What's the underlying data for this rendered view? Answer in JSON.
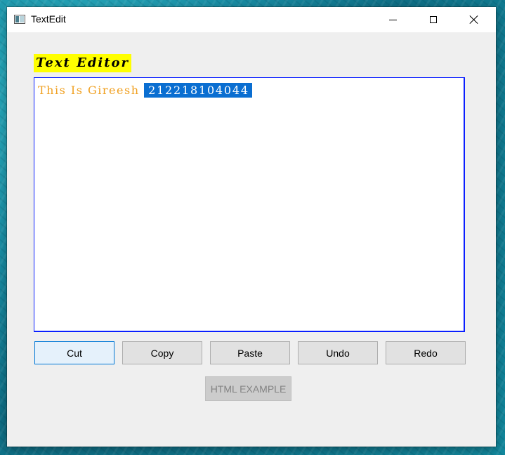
{
  "window": {
    "title": "TextEdit"
  },
  "titlebar_icons": [
    "minimize-icon",
    "maximize-icon",
    "close-icon"
  ],
  "label": {
    "text": "Text Editor",
    "background": "#ffff00"
  },
  "editor": {
    "text_before_selection": "This Is Gireesh ",
    "selected_text": "212218104044",
    "text_color": "#f0a020",
    "selection_color": "#0a6ed1",
    "border_color": "#0a1fff"
  },
  "buttons": {
    "cut": "Cut",
    "copy": "Copy",
    "paste": "Paste",
    "undo": "Undo",
    "redo": "Redo",
    "html_example": "HTML EXAMPLE"
  }
}
